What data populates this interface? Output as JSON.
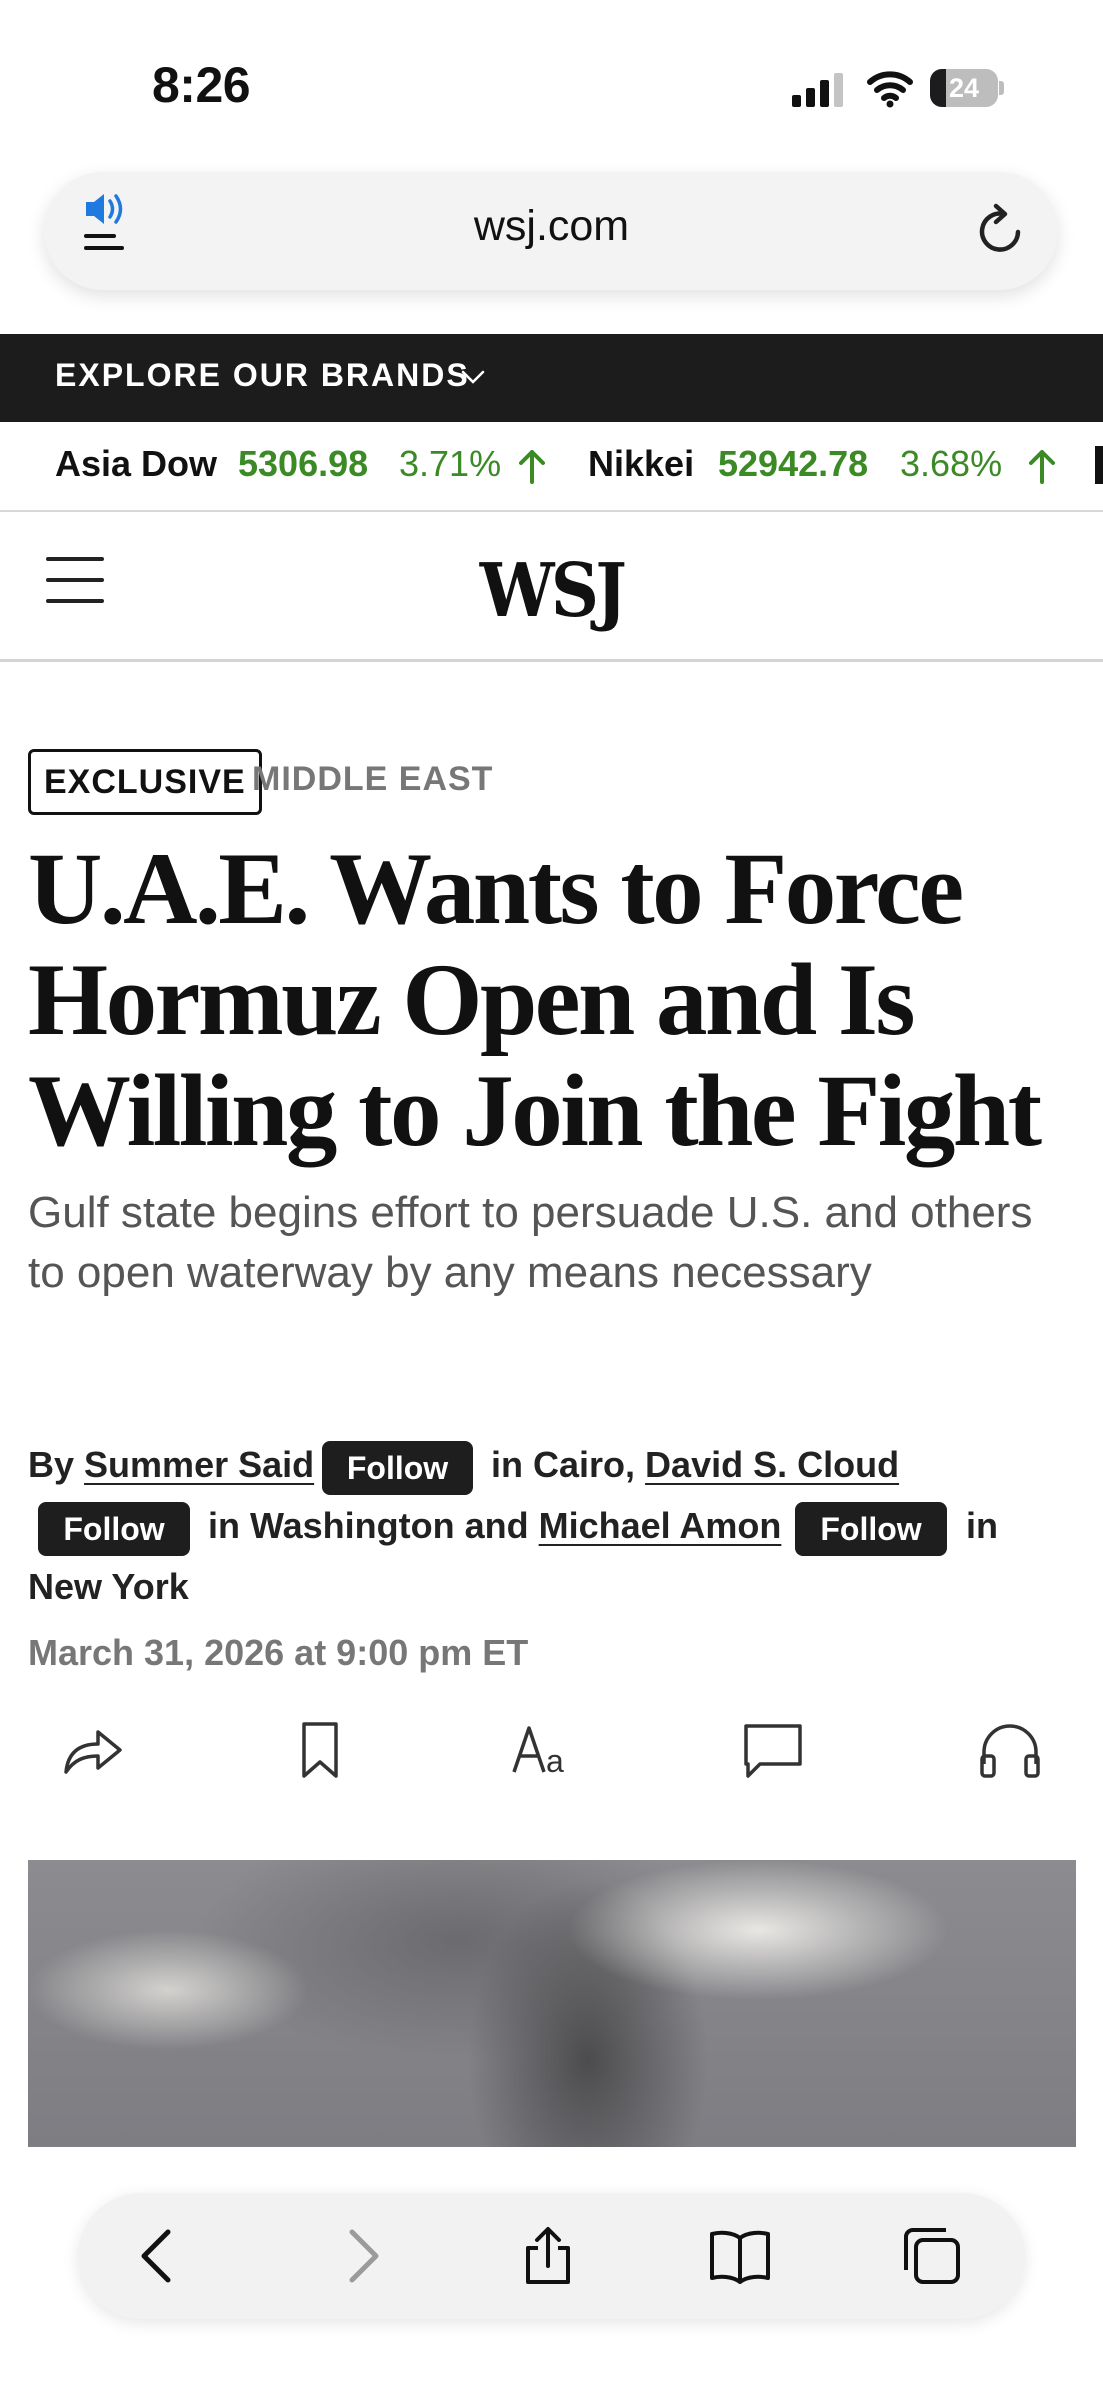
{
  "status_bar": {
    "time": "8:26",
    "battery": "24",
    "battery_level": 0.24
  },
  "browser": {
    "url": "wsj.com",
    "icons": [
      "speaker-icon",
      "menu-lines-icon",
      "reload-icon"
    ]
  },
  "brands_bar": {
    "label": "EXPLORE OUR BRANDS",
    "icon": "chevron-down-icon"
  },
  "ticker": [
    {
      "name": "Asia Dow",
      "value": "5306.98",
      "change": "3.71%",
      "direction": "up"
    },
    {
      "name": "Nikkei",
      "value": "52942.78",
      "change": "3.68%",
      "direction": "up"
    }
  ],
  "header": {
    "logo": "WSJ",
    "menu_icon": "hamburger-icon"
  },
  "article": {
    "flag": "EXCLUSIVE",
    "section": "MIDDLE EAST",
    "headline": "U.A.E. Wants to Force Hormuz Open and Is Willing to Join the Fight",
    "dek": "Gulf state begins effort to persuade U.S. and others to open waterway by any means necessary",
    "byline": {
      "by": "By",
      "authors": [
        {
          "name": "Summer Said",
          "follow": "Follow",
          "location": "in Cairo,"
        },
        {
          "name": "David S. Cloud",
          "follow": "Follow",
          "location": "in Washington and"
        },
        {
          "name": "Michael Amon",
          "follow": "Follow",
          "location": "in"
        }
      ],
      "last_location": "New York"
    },
    "date": "March 31, 2026 at 9:00 pm ET"
  },
  "article_tools": [
    "share-icon",
    "bookmark-icon",
    "text-size-icon",
    "comment-icon",
    "headphones-icon"
  ],
  "safari_toolbar": [
    "back-icon",
    "forward-icon",
    "share-icon",
    "bookmarks-icon",
    "tabs-icon"
  ],
  "colors": {
    "accent_green": "#3b8a26",
    "dark_bar": "#1c1c1c",
    "speaker_blue": "#1f7ae0"
  }
}
